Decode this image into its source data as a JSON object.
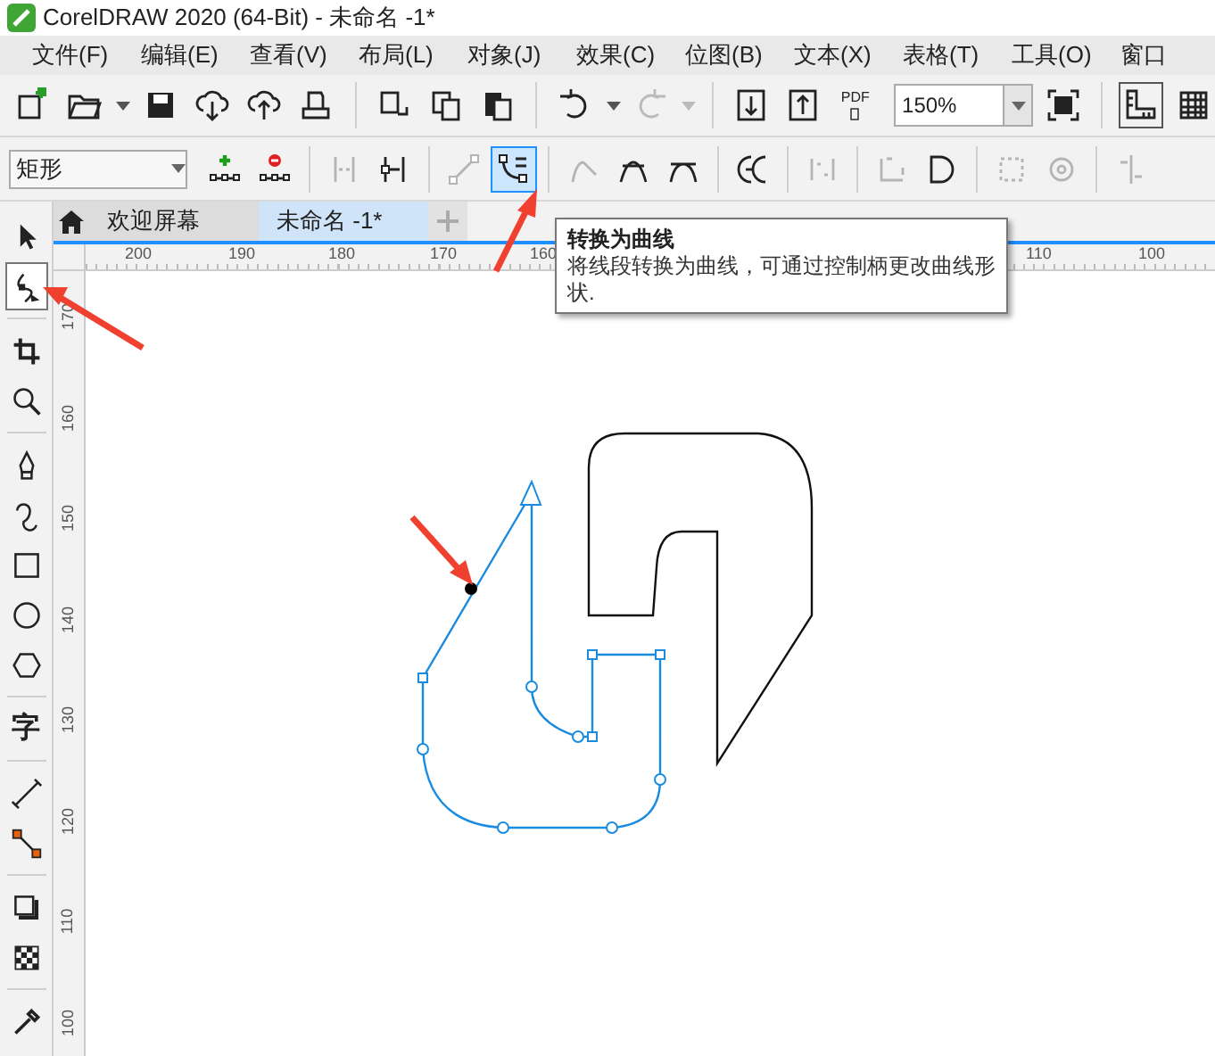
{
  "window": {
    "title": "CorelDRAW 2020 (64-Bit) - 未命名 -1*"
  },
  "menu": [
    "文件(F)",
    "编辑(E)",
    "查看(V)",
    "布局(L)",
    "对象(J)",
    "效果(C)",
    "位图(B)",
    "文本(X)",
    "表格(T)",
    "工具(O)",
    "窗口"
  ],
  "toolbar": {
    "pdf_label": "PDF",
    "zoom": "150%"
  },
  "property_bar": {
    "shape_dropdown": "矩形",
    "tools": [
      {
        "kind": "add-node",
        "disabled": false,
        "selected": false
      },
      {
        "kind": "delete-node",
        "disabled": false,
        "selected": false
      },
      {
        "kind": "join-nodes",
        "disabled": true,
        "selected": false
      },
      {
        "kind": "break-curve",
        "disabled": false,
        "selected": false
      },
      {
        "kind": "to-line",
        "disabled": true,
        "selected": false
      },
      {
        "kind": "to-curve",
        "disabled": false,
        "selected": true
      },
      {
        "kind": "cusp",
        "disabled": true,
        "selected": false
      },
      {
        "kind": "smooth",
        "disabled": false,
        "selected": false
      },
      {
        "kind": "symmetric",
        "disabled": false,
        "selected": false
      },
      {
        "kind": "reverse",
        "disabled": false,
        "selected": false
      },
      {
        "kind": "extend",
        "disabled": true,
        "selected": false
      },
      {
        "kind": "extract",
        "disabled": true,
        "selected": false
      },
      {
        "kind": "close",
        "disabled": false,
        "selected": false
      },
      {
        "kind": "stretch",
        "disabled": true,
        "selected": false
      },
      {
        "kind": "rotate",
        "disabled": true,
        "selected": false
      },
      {
        "kind": "align",
        "disabled": true,
        "selected": false
      }
    ]
  },
  "tabs": [
    {
      "label": "欢迎屏幕",
      "selected": false
    },
    {
      "label": "未命名 -1*",
      "selected": true
    }
  ],
  "tooltip": {
    "title": "转换为曲线",
    "body": "将线段转换为曲线，可通过控制柄更改曲线形状."
  },
  "toolbox": [
    {
      "kind": "pick",
      "selected": false
    },
    {
      "kind": "shape",
      "selected": true
    },
    {
      "kind": "crop",
      "selected": false
    },
    {
      "kind": "zoom",
      "selected": false
    },
    {
      "kind": "pen",
      "selected": false
    },
    {
      "kind": "curve",
      "selected": false
    },
    {
      "kind": "rectangle",
      "selected": false
    },
    {
      "kind": "ellipse",
      "selected": false
    },
    {
      "kind": "polygon",
      "selected": false
    },
    {
      "kind": "text",
      "selected": false,
      "glyph": "字"
    },
    {
      "kind": "dimension",
      "selected": false
    },
    {
      "kind": "connector",
      "selected": false
    },
    {
      "kind": "shadow",
      "selected": false
    },
    {
      "kind": "transparency",
      "selected": false
    },
    {
      "kind": "eyedropper",
      "selected": false
    }
  ],
  "ruler_h": [
    "200",
    "190",
    "180",
    "170",
    "160",
    "110",
    "100"
  ],
  "ruler_v": [
    "170",
    "160",
    "150",
    "140",
    "130",
    "120",
    "110",
    "100"
  ]
}
